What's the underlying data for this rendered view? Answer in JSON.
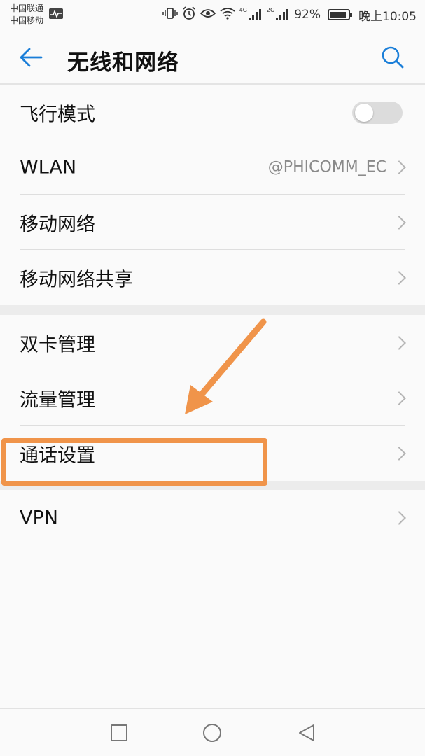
{
  "status_bar": {
    "carrier_1": "中国联通",
    "carrier_2": "中国移动",
    "network_tag_1": "4G",
    "network_tag_2": "2G",
    "battery": "92%",
    "time": "晚上10:05"
  },
  "toolbar": {
    "title": "无线和网络"
  },
  "groups": [
    {
      "items": [
        {
          "label": "飞行模式",
          "type": "toggle",
          "enabled": false
        },
        {
          "label": "WLAN",
          "value": "@PHICOMM_EC",
          "type": "link"
        },
        {
          "label": "移动网络",
          "type": "link"
        },
        {
          "label": "移动网络共享",
          "type": "link"
        }
      ]
    },
    {
      "items": [
        {
          "label": "双卡管理",
          "type": "link"
        },
        {
          "label": "流量管理",
          "type": "link"
        },
        {
          "label": "通话设置",
          "type": "link"
        }
      ]
    },
    {
      "items": [
        {
          "label": "VPN",
          "type": "link"
        }
      ]
    }
  ],
  "colors": {
    "accent": "#1a7ed8",
    "annotation": "#f0944a",
    "background": "#fafafa",
    "section_gap": "#ececec"
  }
}
